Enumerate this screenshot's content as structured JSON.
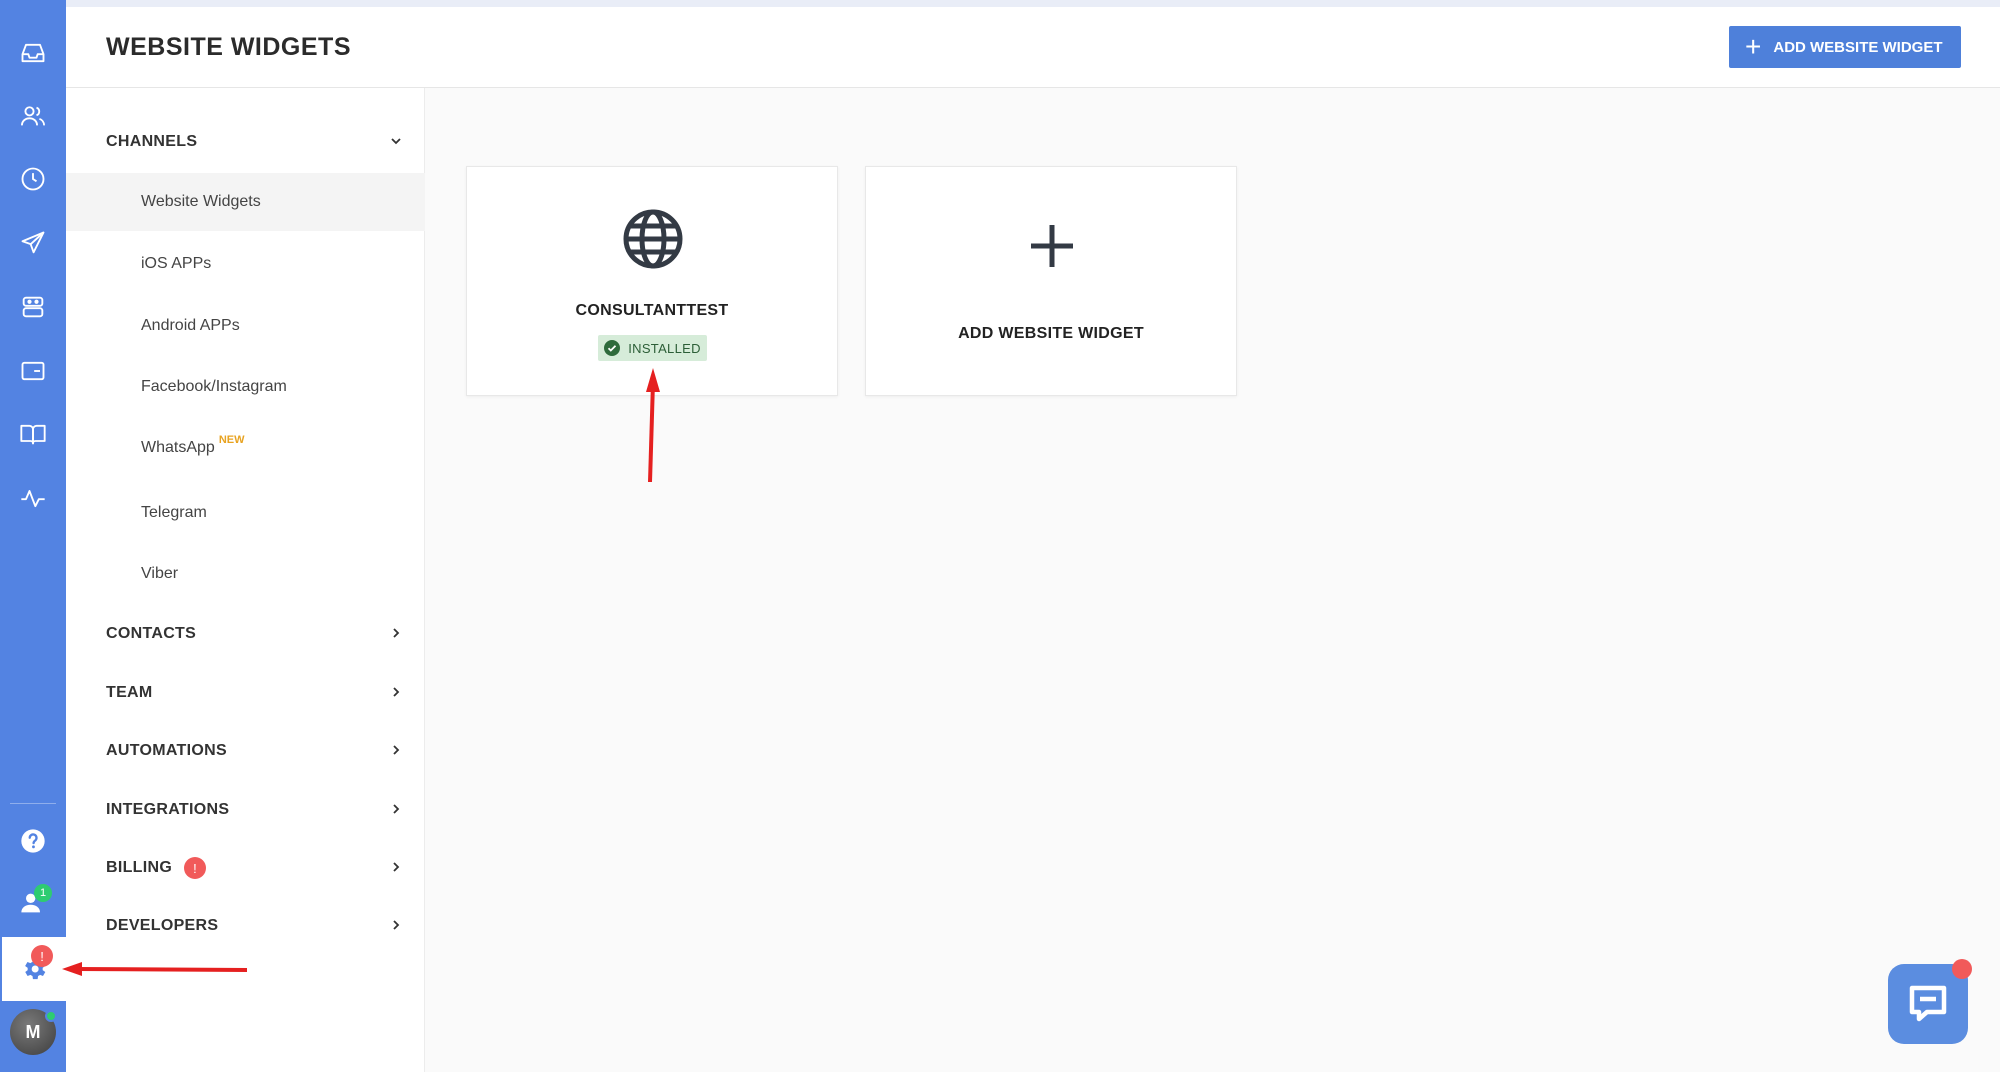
{
  "header": {
    "title": "WEBSITE WIDGETS",
    "add_button_label": "ADD WEBSITE WIDGET"
  },
  "rail": {
    "icons": [
      "inbox-icon",
      "contacts-icon",
      "history-icon",
      "send-icon",
      "bot-icon",
      "widget-icon",
      "knowledge-book-icon",
      "analytics-icon",
      "help-icon",
      "team-icon",
      "settings-icon"
    ],
    "team_badge": "1",
    "settings_badge": "!",
    "avatar_initial": "M"
  },
  "sidebar": {
    "channels": {
      "label": "CHANNELS",
      "items": [
        {
          "label": "Website Widgets",
          "active": true
        },
        {
          "label": "iOS APPs"
        },
        {
          "label": "Android APPs"
        },
        {
          "label": "Facebook/Instagram"
        },
        {
          "label": "WhatsApp",
          "tag": "NEW"
        },
        {
          "label": "Telegram"
        },
        {
          "label": "Viber"
        }
      ]
    },
    "sections": [
      {
        "label": "CONTACTS"
      },
      {
        "label": "TEAM"
      },
      {
        "label": "AUTOMATIONS"
      },
      {
        "label": "INTEGRATIONS"
      },
      {
        "label": "BILLING",
        "badge": "!"
      },
      {
        "label": "DEVELOPERS"
      }
    ]
  },
  "cards": [
    {
      "title": "CONSULTANTTEST",
      "status": "INSTALLED",
      "icon": "globe-icon"
    },
    {
      "title": "ADD WEBSITE WIDGET",
      "icon": "plus-icon"
    }
  ],
  "colors": {
    "rail": "#5383e2",
    "primary_button": "#4e80da",
    "installed_bg": "#d6ecd9",
    "badge_red": "#f15a5a",
    "badge_green": "#2ecc71"
  }
}
